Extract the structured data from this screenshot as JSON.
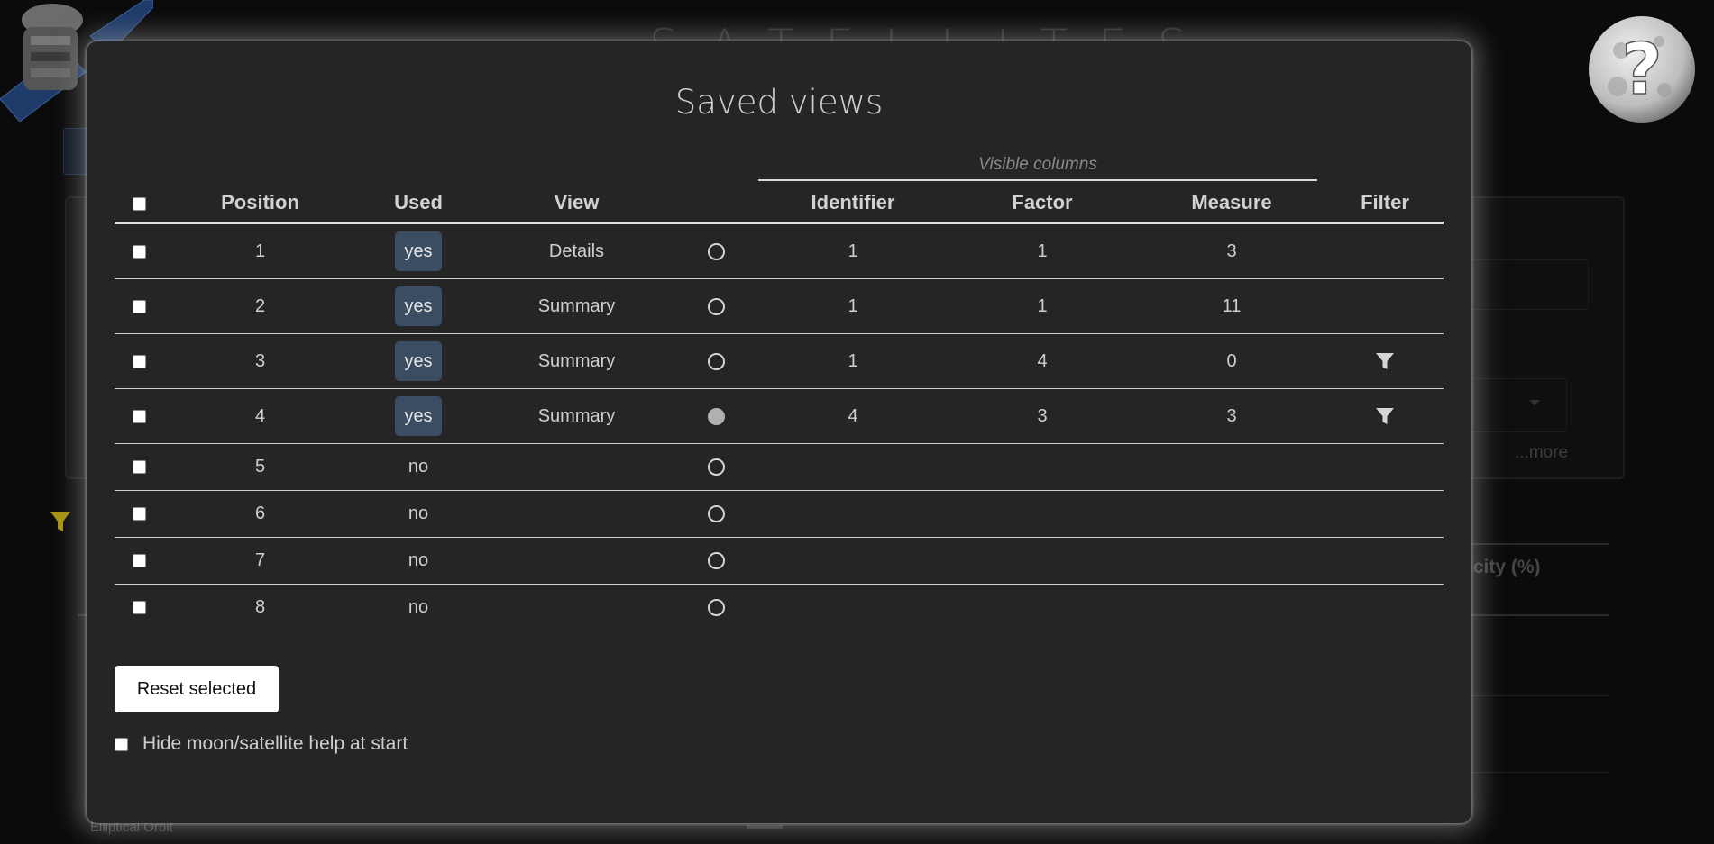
{
  "background": {
    "page_title": "SATELLITES",
    "more_link": "...more",
    "column_header_fragment": "icity (%)",
    "caption": "Elliptical Orbit"
  },
  "modal": {
    "title": "Saved views",
    "group_label": "Visible columns",
    "headers": {
      "select_all": "",
      "position": "Position",
      "used": "Used",
      "view": "View",
      "active": "",
      "identifier": "Identifier",
      "factor": "Factor",
      "measure": "Measure",
      "filter": "Filter"
    },
    "rows": [
      {
        "position": "1",
        "used": "yes",
        "view": "Details",
        "active": false,
        "identifier": "1",
        "factor": "1",
        "measure": "3",
        "filter": false
      },
      {
        "position": "2",
        "used": "yes",
        "view": "Summary",
        "active": false,
        "identifier": "1",
        "factor": "1",
        "measure": "11",
        "filter": false
      },
      {
        "position": "3",
        "used": "yes",
        "view": "Summary",
        "active": false,
        "identifier": "1",
        "factor": "4",
        "measure": "0",
        "filter": true
      },
      {
        "position": "4",
        "used": "yes",
        "view": "Summary",
        "active": true,
        "identifier": "4",
        "factor": "3",
        "measure": "3",
        "filter": true
      },
      {
        "position": "5",
        "used": "no",
        "view": "",
        "active": false,
        "identifier": "",
        "factor": "",
        "measure": "",
        "filter": false
      },
      {
        "position": "6",
        "used": "no",
        "view": "",
        "active": false,
        "identifier": "",
        "factor": "",
        "measure": "",
        "filter": false
      },
      {
        "position": "7",
        "used": "no",
        "view": "",
        "active": false,
        "identifier": "",
        "factor": "",
        "measure": "",
        "filter": false
      },
      {
        "position": "8",
        "used": "no",
        "view": "",
        "active": false,
        "identifier": "",
        "factor": "",
        "measure": "",
        "filter": false
      }
    ],
    "reset_button": "Reset selected",
    "hide_help_label": "Hide moon/satellite help at start"
  },
  "colors": {
    "modal_bg": "#252525",
    "badge_bg": "#3b4d62",
    "page_bg": "#0b0b0b",
    "filter_accent": "#a89410"
  },
  "icons": {
    "moon": "moon-help-icon",
    "satellite": "satellite-icon",
    "filter": "filter-icon"
  }
}
